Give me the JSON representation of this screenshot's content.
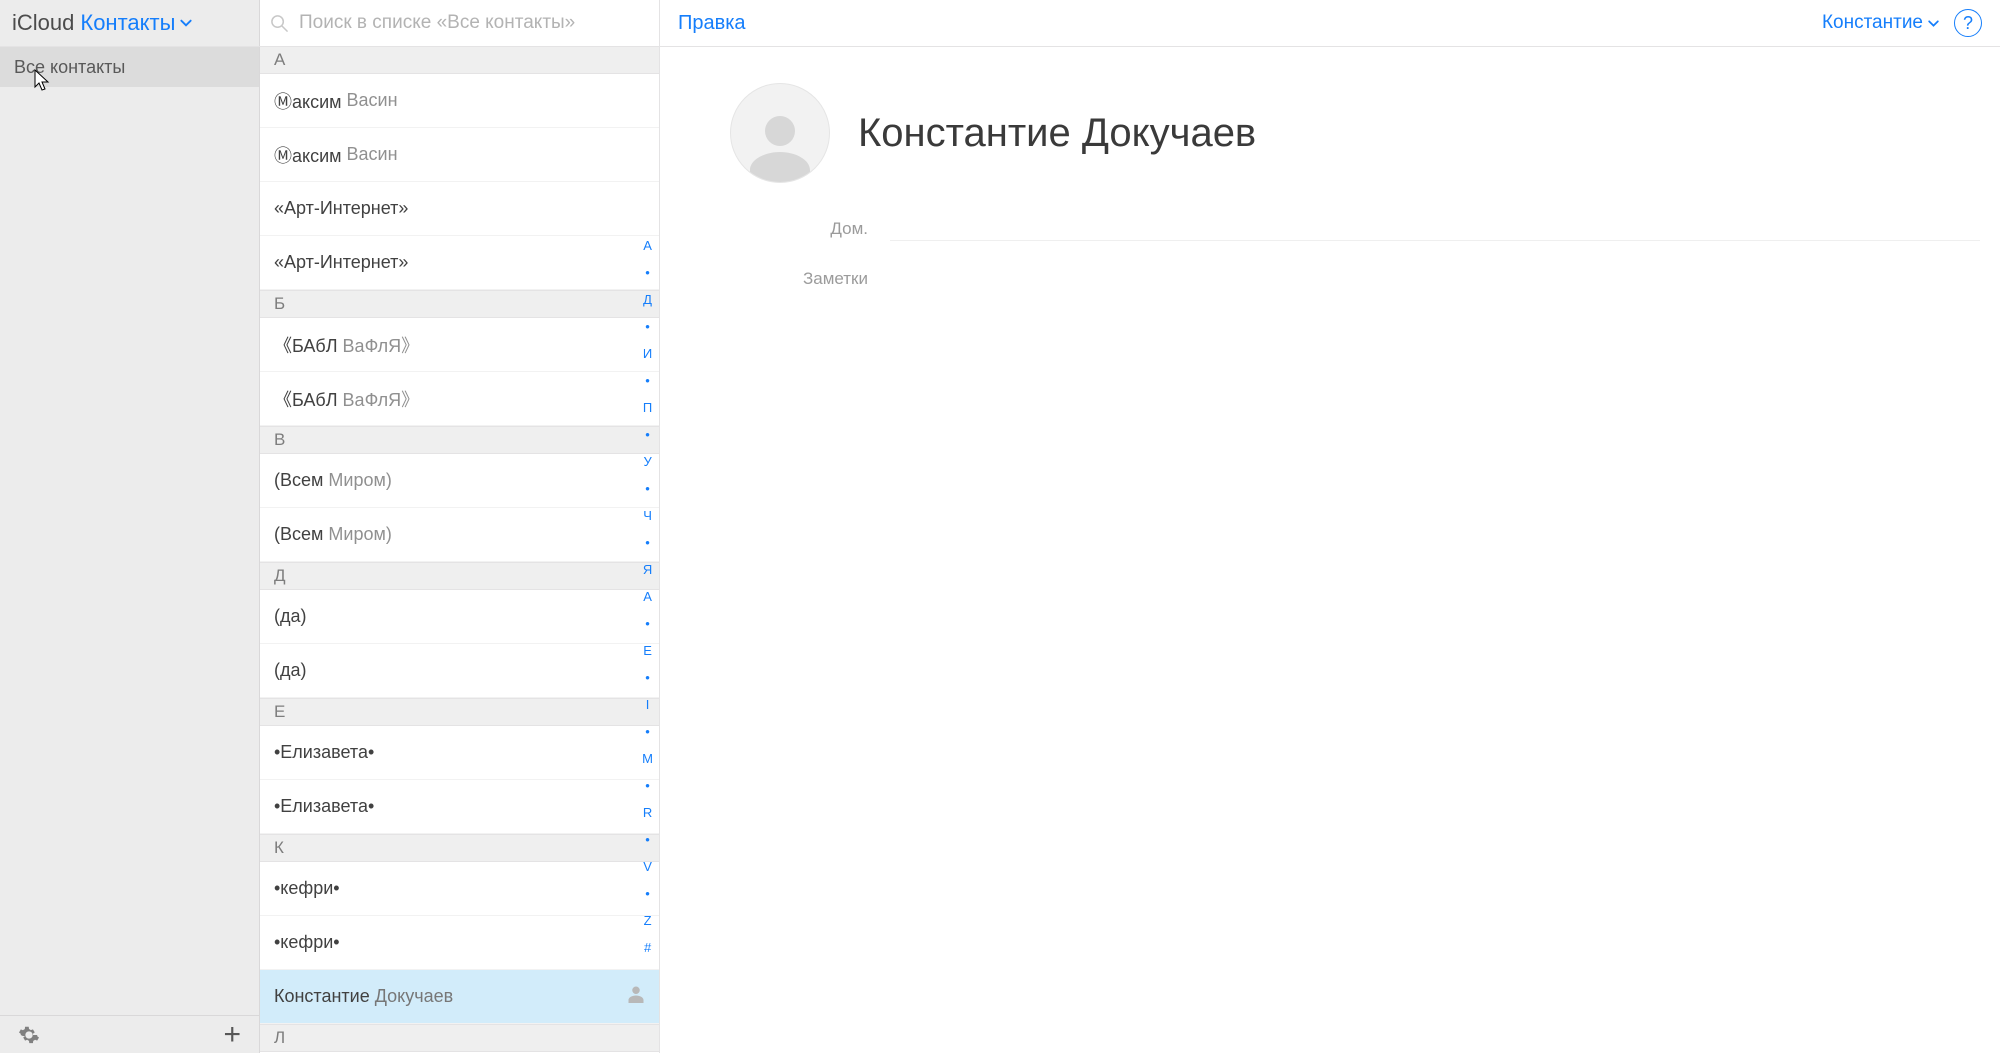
{
  "header": {
    "brand": "iCloud",
    "app_menu": "Контакты",
    "search_placeholder": "Поиск в списке «Все контакты»",
    "edit_label": "Правка",
    "account_name": "Константие"
  },
  "sidebar": {
    "groups": [
      {
        "label": "Все контакты",
        "selected": true
      }
    ]
  },
  "contact_sections": [
    {
      "letter": "А",
      "items": [
        {
          "first": "Ⓜаксим",
          "last": "Васин"
        },
        {
          "first": "Ⓜаксим",
          "last": "Васин"
        },
        {
          "first": "«Арт-Интернет»",
          "last": ""
        },
        {
          "first": "«Арт-Интернет»",
          "last": ""
        }
      ]
    },
    {
      "letter": "Б",
      "items": [
        {
          "first": "《БАбЛ",
          "last": "ВаФлЯ》"
        },
        {
          "first": "《БАбЛ",
          "last": "ВаФлЯ》"
        }
      ]
    },
    {
      "letter": "В",
      "items": [
        {
          "first": "(Всем",
          "last": "Миром)"
        },
        {
          "first": "(Всем",
          "last": "Миром)"
        }
      ]
    },
    {
      "letter": "Д",
      "items": [
        {
          "first": "(да)",
          "last": ""
        },
        {
          "first": "(да)",
          "last": ""
        }
      ]
    },
    {
      "letter": "Е",
      "items": [
        {
          "first": "•Елизавета•",
          "last": ""
        },
        {
          "first": "•Елизавета•",
          "last": ""
        }
      ]
    },
    {
      "letter": "К",
      "items": [
        {
          "first": "•кефри•",
          "last": ""
        },
        {
          "first": "•кефри•",
          "last": ""
        },
        {
          "first": "Константие",
          "last": "Докучаев",
          "selected": true,
          "silhouette": true
        }
      ]
    },
    {
      "letter": "Л",
      "items": []
    }
  ],
  "alpha_index": [
    "А",
    "•",
    "Д",
    "•",
    "И",
    "•",
    "П",
    "•",
    "У",
    "•",
    "Ч",
    "•",
    "Я",
    "A",
    "•",
    "E",
    "•",
    "I",
    "•",
    "M",
    "•",
    "R",
    "•",
    "V",
    "•",
    "Z",
    "#"
  ],
  "details": {
    "name": "Константие Докучаев",
    "fields": [
      {
        "label": "Дом.",
        "value": ""
      },
      {
        "label": "Заметки",
        "value": ""
      }
    ]
  }
}
